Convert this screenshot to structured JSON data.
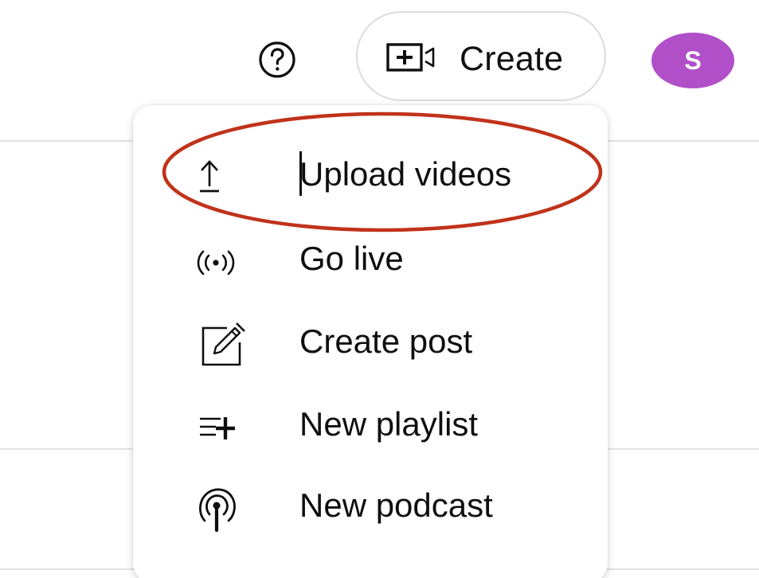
{
  "header": {
    "help_icon": "help-circle-icon",
    "create_button": {
      "label": "Create",
      "icon": "video-add-icon"
    },
    "avatar": {
      "initial": "S",
      "color": "#b04fc8"
    }
  },
  "create_menu": {
    "items": [
      {
        "label": "Upload videos",
        "icon": "upload-icon"
      },
      {
        "label": "Go live",
        "icon": "live-broadcast-icon"
      },
      {
        "label": "Create post",
        "icon": "edit-post-icon"
      },
      {
        "label": "New playlist",
        "icon": "playlist-add-icon"
      },
      {
        "label": "New podcast",
        "icon": "podcast-icon"
      }
    ],
    "highlighted_item": "Upload videos",
    "highlight_color": "#c0321a"
  }
}
